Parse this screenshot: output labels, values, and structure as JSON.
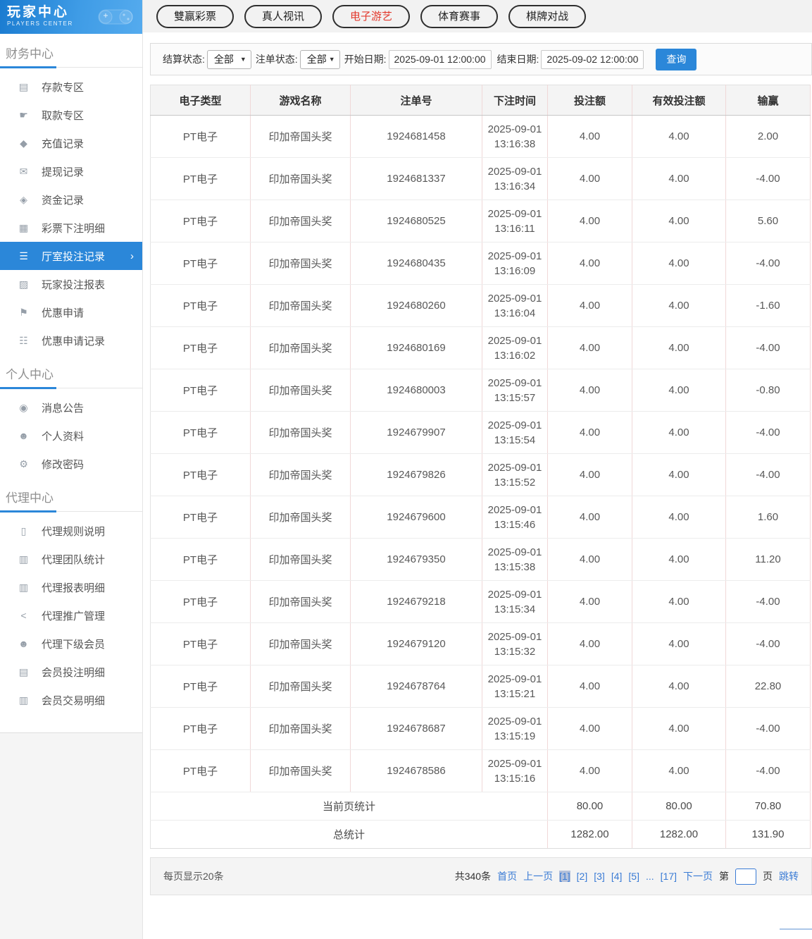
{
  "brand": {
    "title": "玩家中心",
    "subtitle": "PLAYERS CENTER"
  },
  "sidebar": {
    "sections": [
      {
        "title": "财务中心",
        "items": [
          {
            "label": "存款专区",
            "icon": "wallet-icon"
          },
          {
            "label": "取款专区",
            "icon": "hand-money-icon"
          },
          {
            "label": "充值记录",
            "icon": "moneybag-icon"
          },
          {
            "label": "提现记录",
            "icon": "envelope-money-icon"
          },
          {
            "label": "资金记录",
            "icon": "funds-icon"
          },
          {
            "label": "彩票下注明细",
            "icon": "lottery-detail-icon"
          },
          {
            "label": "厅室投注记录",
            "icon": "hall-records-icon",
            "active": true,
            "arrow": "›"
          },
          {
            "label": "玩家投注报表",
            "icon": "report-chart-icon"
          },
          {
            "label": "优惠申请",
            "icon": "gift-flag-icon"
          },
          {
            "label": "优惠申请记录",
            "icon": "promo-records-icon"
          }
        ]
      },
      {
        "title": "个人中心",
        "items": [
          {
            "label": "消息公告",
            "icon": "bell-icon"
          },
          {
            "label": "个人资料",
            "icon": "person-icon"
          },
          {
            "label": "修改密码",
            "icon": "gear-icon"
          }
        ]
      },
      {
        "title": "代理中心",
        "items": [
          {
            "label": "代理规则说明",
            "icon": "document-icon"
          },
          {
            "label": "代理团队统计",
            "icon": "team-stats-icon"
          },
          {
            "label": "代理报表明细",
            "icon": "report-detail-icon"
          },
          {
            "label": "代理推广管理",
            "icon": "share-icon"
          },
          {
            "label": "代理下级会员",
            "icon": "members-icon"
          },
          {
            "label": "会员投注明细",
            "icon": "bet-detail-icon"
          },
          {
            "label": "会员交易明细",
            "icon": "trade-detail-icon"
          }
        ]
      }
    ]
  },
  "tabs": [
    {
      "label": "雙赢彩票",
      "active": false
    },
    {
      "label": "真人视讯",
      "active": false
    },
    {
      "label": "电子游艺",
      "active": true
    },
    {
      "label": "体育赛事",
      "active": false
    },
    {
      "label": "棋牌对战",
      "active": false
    }
  ],
  "filters": {
    "settle_label": "结算状态:",
    "settle_value": "全部",
    "order_label": "注单状态:",
    "order_value": "全部",
    "start_label": "开始日期:",
    "start_value": "2025-09-01 12:00:00",
    "end_label": "结束日期:",
    "end_value": "2025-09-02 12:00:00",
    "query_label": "查询"
  },
  "table": {
    "headers": [
      "电子类型",
      "游戏名称",
      "注单号",
      "下注时间",
      "投注额",
      "有效投注额",
      "输赢"
    ],
    "rows": [
      {
        "type": "PT电子",
        "game": "印加帝国头奖",
        "bet_no": "1924681458",
        "bet_time": "2025-09-01 13:16:38",
        "amount": "4.00",
        "valid_amount": "4.00",
        "win_loss": "2.00"
      },
      {
        "type": "PT电子",
        "game": "印加帝国头奖",
        "bet_no": "1924681337",
        "bet_time": "2025-09-01 13:16:34",
        "amount": "4.00",
        "valid_amount": "4.00",
        "win_loss": "-4.00"
      },
      {
        "type": "PT电子",
        "game": "印加帝国头奖",
        "bet_no": "1924680525",
        "bet_time": "2025-09-01 13:16:11",
        "amount": "4.00",
        "valid_amount": "4.00",
        "win_loss": "5.60"
      },
      {
        "type": "PT电子",
        "game": "印加帝国头奖",
        "bet_no": "1924680435",
        "bet_time": "2025-09-01 13:16:09",
        "amount": "4.00",
        "valid_amount": "4.00",
        "win_loss": "-4.00"
      },
      {
        "type": "PT电子",
        "game": "印加帝国头奖",
        "bet_no": "1924680260",
        "bet_time": "2025-09-01 13:16:04",
        "amount": "4.00",
        "valid_amount": "4.00",
        "win_loss": "-1.60"
      },
      {
        "type": "PT电子",
        "game": "印加帝国头奖",
        "bet_no": "1924680169",
        "bet_time": "2025-09-01 13:16:02",
        "amount": "4.00",
        "valid_amount": "4.00",
        "win_loss": "-4.00"
      },
      {
        "type": "PT电子",
        "game": "印加帝国头奖",
        "bet_no": "1924680003",
        "bet_time": "2025-09-01 13:15:57",
        "amount": "4.00",
        "valid_amount": "4.00",
        "win_loss": "-0.80"
      },
      {
        "type": "PT电子",
        "game": "印加帝国头奖",
        "bet_no": "1924679907",
        "bet_time": "2025-09-01 13:15:54",
        "amount": "4.00",
        "valid_amount": "4.00",
        "win_loss": "-4.00"
      },
      {
        "type": "PT电子",
        "game": "印加帝国头奖",
        "bet_no": "1924679826",
        "bet_time": "2025-09-01 13:15:52",
        "amount": "4.00",
        "valid_amount": "4.00",
        "win_loss": "-4.00"
      },
      {
        "type": "PT电子",
        "game": "印加帝国头奖",
        "bet_no": "1924679600",
        "bet_time": "2025-09-01 13:15:46",
        "amount": "4.00",
        "valid_amount": "4.00",
        "win_loss": "1.60"
      },
      {
        "type": "PT电子",
        "game": "印加帝国头奖",
        "bet_no": "1924679350",
        "bet_time": "2025-09-01 13:15:38",
        "amount": "4.00",
        "valid_amount": "4.00",
        "win_loss": "11.20"
      },
      {
        "type": "PT电子",
        "game": "印加帝国头奖",
        "bet_no": "1924679218",
        "bet_time": "2025-09-01 13:15:34",
        "amount": "4.00",
        "valid_amount": "4.00",
        "win_loss": "-4.00"
      },
      {
        "type": "PT电子",
        "game": "印加帝国头奖",
        "bet_no": "1924679120",
        "bet_time": "2025-09-01 13:15:32",
        "amount": "4.00",
        "valid_amount": "4.00",
        "win_loss": "-4.00"
      },
      {
        "type": "PT电子",
        "game": "印加帝国头奖",
        "bet_no": "1924678764",
        "bet_time": "2025-09-01 13:15:21",
        "amount": "4.00",
        "valid_amount": "4.00",
        "win_loss": "22.80"
      },
      {
        "type": "PT电子",
        "game": "印加帝国头奖",
        "bet_no": "1924678687",
        "bet_time": "2025-09-01 13:15:19",
        "amount": "4.00",
        "valid_amount": "4.00",
        "win_loss": "-4.00"
      },
      {
        "type": "PT电子",
        "game": "印加帝国头奖",
        "bet_no": "1924678586",
        "bet_time": "2025-09-01 13:15:16",
        "amount": "4.00",
        "valid_amount": "4.00",
        "win_loss": "-4.00"
      }
    ],
    "page_summary": {
      "label": "当前页统计",
      "amount": "80.00",
      "valid_amount": "80.00",
      "win_loss": "70.80"
    },
    "total_summary": {
      "label": "总统计",
      "amount": "1282.00",
      "valid_amount": "1282.00",
      "win_loss": "131.90"
    }
  },
  "pagination": {
    "per_page": "每页显示20条",
    "total": "共340条",
    "first": "首页",
    "prev": "上一页",
    "pages": [
      {
        "label": "[1]",
        "current": true
      },
      {
        "label": "[2]"
      },
      {
        "label": "[3]"
      },
      {
        "label": "[4]"
      },
      {
        "label": "[5]"
      },
      {
        "label": "..."
      },
      {
        "label": "[17]"
      }
    ],
    "next": "下一页",
    "jump_prefix": "第",
    "jump_suffix": "页",
    "jump_label": "跳转"
  }
}
